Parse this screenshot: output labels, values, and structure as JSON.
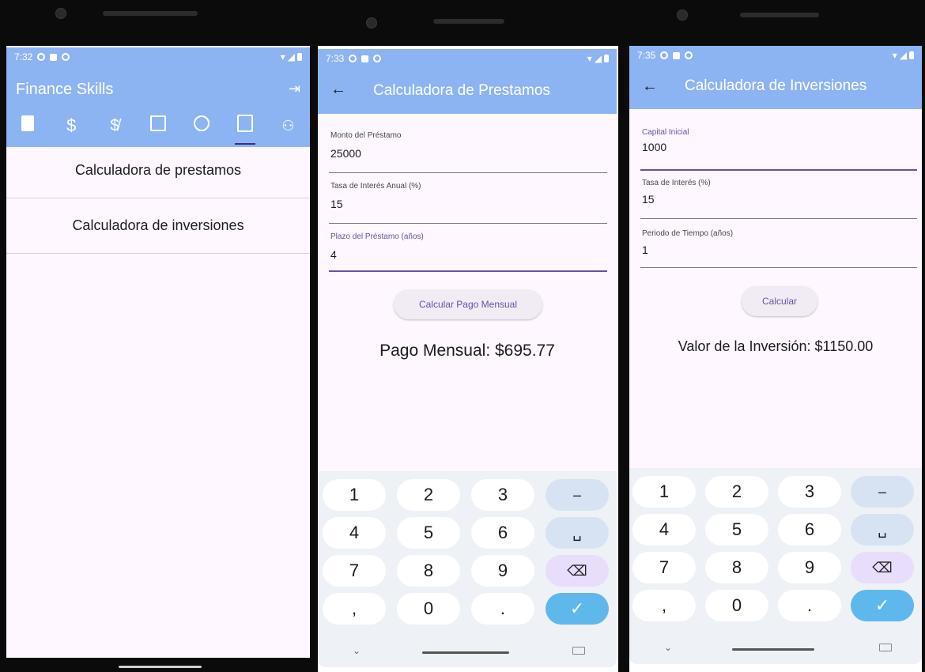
{
  "phone1": {
    "status_time": "7:32",
    "app_title": "Finance Skills",
    "icons": [
      "book-icon",
      "dollar-icon",
      "money-off-icon",
      "chart-icon",
      "alarm-icon",
      "calculator-icon",
      "people-icon"
    ],
    "menu": [
      {
        "label": "Calculadora de prestamos"
      },
      {
        "label": "Calculadora de inversiones"
      }
    ]
  },
  "phone2": {
    "status_time": "7:33",
    "title": "Calculadora de Prestamos",
    "fields": [
      {
        "label": "Monto del Préstamo",
        "value": "25000"
      },
      {
        "label": "Tasa de Interés Anual (%)",
        "value": "15"
      },
      {
        "label": "Plazo del Préstamo (años)",
        "value": "4"
      }
    ],
    "button": "Calcular Pago Mensual",
    "result": "Pago Mensual: $695.77"
  },
  "phone3": {
    "status_time": "7:35",
    "title": "Calculadora de Inversiones",
    "fields": [
      {
        "label": "Capital Inicial",
        "value": "1000"
      },
      {
        "label": "Tasa de Interés (%)",
        "value": "15"
      },
      {
        "label": "Periodo de Tiempo (años)",
        "value": "1"
      }
    ],
    "button": "Calcular",
    "result": "Valor de la Inversión: $1150.00"
  },
  "keyboard": {
    "keys": [
      "1",
      "2",
      "3",
      "–",
      "4",
      "5",
      "6",
      "␣",
      "7",
      "8",
      "9",
      "⌫",
      ",",
      "0",
      ".",
      "✓"
    ]
  },
  "colors": {
    "appbar": "#8db4f2",
    "accent": "#6750a4",
    "background": "#fef7ff",
    "done_key": "#5eb8ec"
  }
}
